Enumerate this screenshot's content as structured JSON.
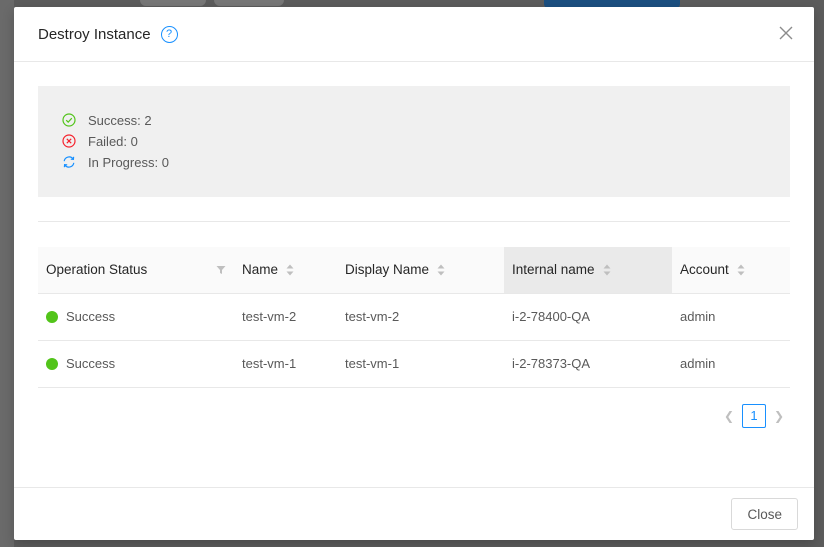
{
  "modal": {
    "title": "Destroy Instance",
    "close_button_label": "Close"
  },
  "summary": {
    "success": "Success: 2",
    "failed": "Failed: 0",
    "in_progress": "In Progress: 0"
  },
  "table": {
    "columns": [
      "Operation Status",
      "Name",
      "Display Name",
      "Internal name",
      "Account"
    ],
    "rows": [
      {
        "status": "Success",
        "name": "test-vm-2",
        "display_name": "test-vm-2",
        "internal_name": "i-2-78400-QA",
        "account": "admin"
      },
      {
        "status": "Success",
        "name": "test-vm-1",
        "display_name": "test-vm-1",
        "internal_name": "i-2-78373-QA",
        "account": "admin"
      }
    ]
  },
  "pagination": {
    "current_page": "1"
  },
  "colors": {
    "success": "#52c41a",
    "failed": "#f5222d",
    "in_progress": "#1890ff",
    "primary": "#1890ff"
  },
  "icons": {
    "help": "question-circle-icon",
    "close": "close-icon",
    "success": "check-circle-icon",
    "failed": "close-circle-icon",
    "in_progress": "sync-icon"
  }
}
